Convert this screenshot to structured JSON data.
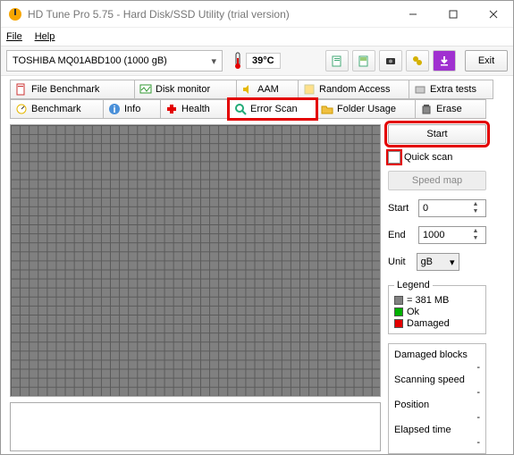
{
  "window": {
    "title": "HD Tune Pro 5.75 - Hard Disk/SSD Utility (trial version)"
  },
  "menu": {
    "file": "File",
    "help": "Help"
  },
  "toolbar": {
    "drive": "TOSHIBA MQ01ABD100 (1000 gB)",
    "temperature": "39°C",
    "exit": "Exit"
  },
  "tabs": {
    "row1": [
      {
        "label": "File Benchmark"
      },
      {
        "label": "Disk monitor"
      },
      {
        "label": "AAM"
      },
      {
        "label": "Random Access"
      },
      {
        "label": "Extra tests"
      }
    ],
    "row2": [
      {
        "label": "Benchmark"
      },
      {
        "label": "Info"
      },
      {
        "label": "Health"
      },
      {
        "label": "Error Scan"
      },
      {
        "label": "Folder Usage"
      },
      {
        "label": "Erase"
      }
    ]
  },
  "side": {
    "start": "Start",
    "quickscan": "Quick scan",
    "speedmap": "Speed map",
    "start_label": "Start",
    "start_value": "0",
    "end_label": "End",
    "end_value": "1000",
    "unit_label": "Unit",
    "unit_value": "gB"
  },
  "legend": {
    "title": "Legend",
    "size": "= 381 MB",
    "ok": "Ok",
    "damaged": "Damaged"
  },
  "stats": {
    "damaged_blocks": "Damaged blocks",
    "damaged_blocks_val": "-",
    "scanning_speed": "Scanning speed",
    "scanning_speed_val": "-",
    "position": "Position",
    "position_val": "-",
    "elapsed_time": "Elapsed time",
    "elapsed_time_val": "-"
  }
}
